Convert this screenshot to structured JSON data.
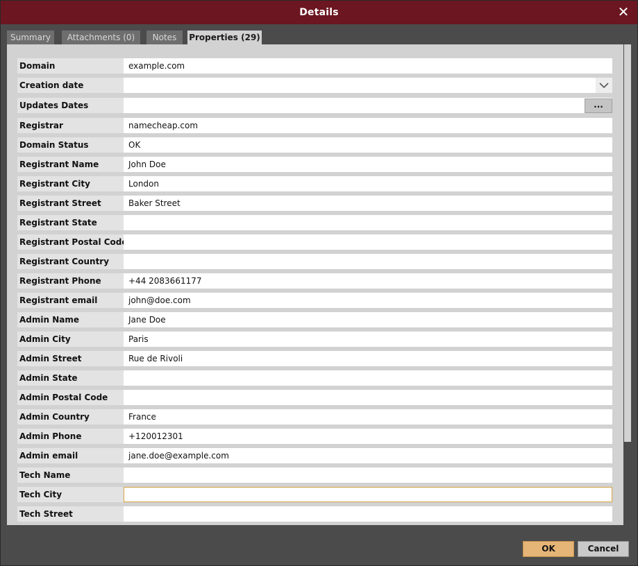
{
  "window": {
    "title": "Details"
  },
  "tabs": [
    {
      "label": "Summary",
      "active": false
    },
    {
      "label": "Attachments (0)",
      "active": false
    },
    {
      "label": "Notes",
      "active": false
    },
    {
      "label": "Properties (29)",
      "active": true
    }
  ],
  "properties": [
    {
      "label": "Domain",
      "value": "example.com"
    },
    {
      "label": "Creation date",
      "value": "",
      "control": "dropdown"
    },
    {
      "label": "Updates Dates",
      "value": "",
      "control": "ellipsis",
      "button_label": "..."
    },
    {
      "label": "Registrar",
      "value": "namecheap.com"
    },
    {
      "label": "Domain Status",
      "value": "OK"
    },
    {
      "label": "Registrant Name",
      "value": "John Doe"
    },
    {
      "label": "Registrant City",
      "value": "London"
    },
    {
      "label": "Registrant Street",
      "value": "Baker Street"
    },
    {
      "label": "Registrant State",
      "value": ""
    },
    {
      "label": "Registrant Postal Code",
      "value": ""
    },
    {
      "label": "Registrant Country",
      "value": ""
    },
    {
      "label": "Registrant Phone",
      "value": "+44 2083661177"
    },
    {
      "label": "Registrant email",
      "value": "john@doe.com"
    },
    {
      "label": "Admin Name",
      "value": "Jane Doe"
    },
    {
      "label": "Admin City",
      "value": "Paris"
    },
    {
      "label": "Admin Street",
      "value": "Rue de Rivoli"
    },
    {
      "label": "Admin State",
      "value": ""
    },
    {
      "label": "Admin Postal Code",
      "value": ""
    },
    {
      "label": "Admin Country",
      "value": "France"
    },
    {
      "label": "Admin Phone",
      "value": "+120012301"
    },
    {
      "label": "Admin email",
      "value": "jane.doe@example.com"
    },
    {
      "label": "Tech Name",
      "value": ""
    },
    {
      "label": "Tech City",
      "value": "",
      "focused": true
    },
    {
      "label": "Tech Street",
      "value": ""
    }
  ],
  "buttons": {
    "ok_label": "OK",
    "cancel_label": "Cancel"
  },
  "icons": {
    "close": "close-icon",
    "dropdown": "chevron-down-icon"
  },
  "colors": {
    "title_bar": "#6b1620",
    "ok_button": "#e5b578",
    "focus_border": "#d9a441"
  }
}
